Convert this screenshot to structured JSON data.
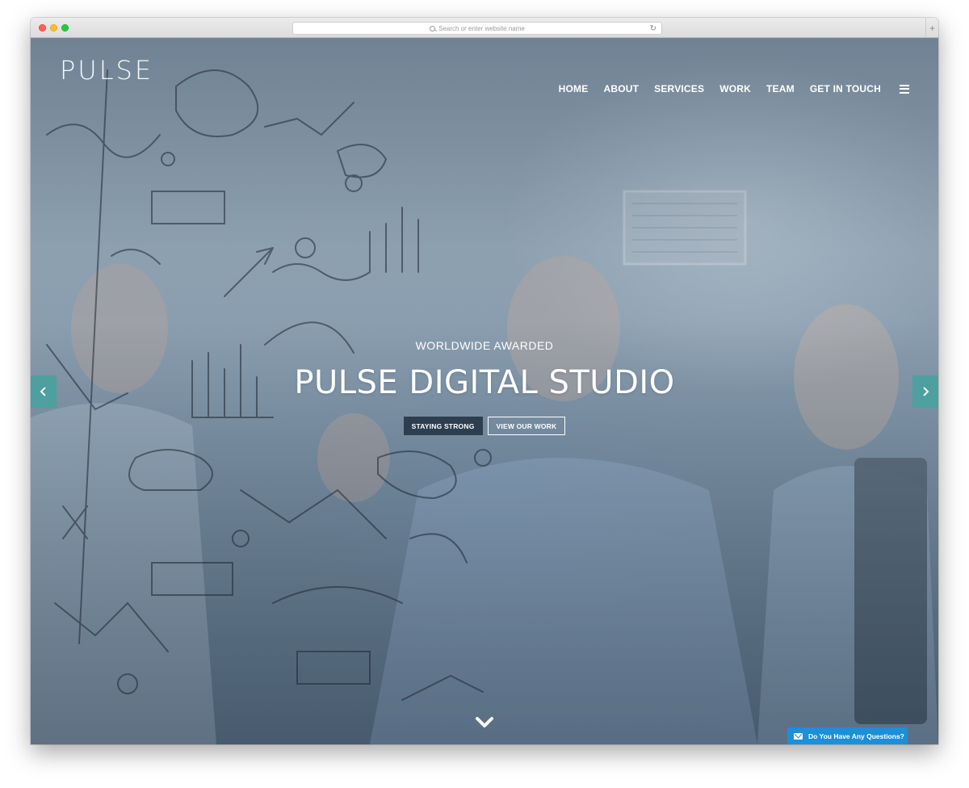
{
  "browser": {
    "url_placeholder": "Search or enter website name",
    "reload_icon": "reload-icon",
    "newtab_label": "+"
  },
  "site": {
    "logo": "PULSE",
    "nav": [
      "HOME",
      "ABOUT",
      "SERVICES",
      "WORK",
      "TEAM",
      "GET IN TOUCH"
    ],
    "menu_icon": "hamburger-menu-icon"
  },
  "hero": {
    "eyebrow": "WORLDWIDE AWARDED",
    "title": "PULSE DIGITAL STUDIO",
    "primary_button": "STAYING STRONG",
    "secondary_button": "VIEW OUR WORK",
    "prev_icon": "chevron-left-icon",
    "next_icon": "chevron-right-icon",
    "scroll_icon": "chevron-down-icon"
  },
  "chat": {
    "label": "Do You Have Any Questions?",
    "icon": "envelope-icon"
  },
  "colors": {
    "accent_teal": "#4aa1a0",
    "primary_button": "#2c3e50",
    "chat_blue": "#1b8fd8"
  }
}
